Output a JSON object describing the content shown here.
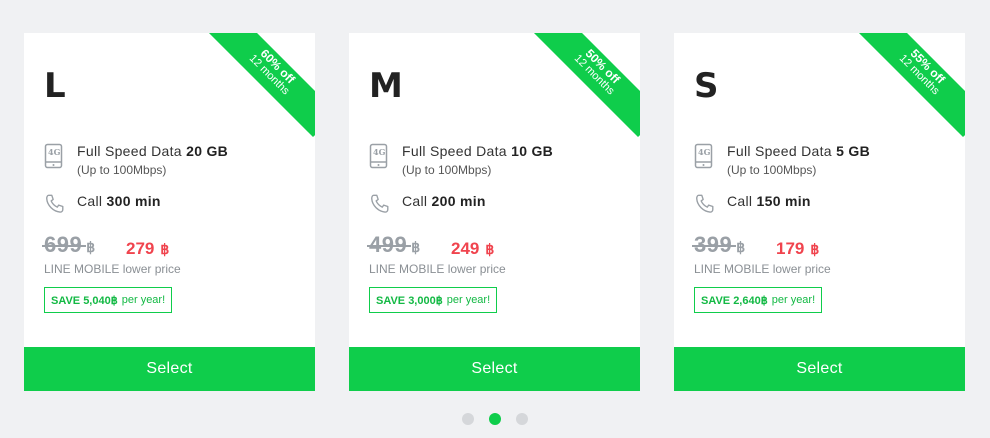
{
  "colors": {
    "accent": "#0fcd4b",
    "sale_price": "#f0444e",
    "old_price": "#9aa0a6",
    "background": "#f0f1f3"
  },
  "plans": [
    {
      "ribbon_pct": "60% off",
      "ribbon_months": "12 months",
      "name": "L",
      "data_label": "Full Speed Data",
      "data_amount": "20 GB",
      "data_sub": "(Up to 100Mbps)",
      "call_label": "Call",
      "call_amount": "300 min",
      "old_price": "699",
      "currency": "฿",
      "new_price": "279",
      "lower_price_label": "LINE MOBILE lower price",
      "save_strong": "SAVE 5,040฿",
      "save_suffix": "per year!",
      "select_label": "Select"
    },
    {
      "ribbon_pct": "50% off",
      "ribbon_months": "12 months",
      "name": "M",
      "data_label": "Full Speed Data",
      "data_amount": "10 GB",
      "data_sub": "(Up to 100Mbps)",
      "call_label": "Call",
      "call_amount": "200 min",
      "old_price": "499",
      "currency": "฿",
      "new_price": "249",
      "lower_price_label": "LINE MOBILE lower price",
      "save_strong": "SAVE 3,000฿",
      "save_suffix": "per year!",
      "select_label": "Select"
    },
    {
      "ribbon_pct": "55% off",
      "ribbon_months": "12 months",
      "name": "S",
      "data_label": "Full Speed Data",
      "data_amount": "5 GB",
      "data_sub": "(Up to 100Mbps)",
      "call_label": "Call",
      "call_amount": "150 min",
      "old_price": "399",
      "currency": "฿",
      "new_price": "179",
      "lower_price_label": "LINE MOBILE lower price",
      "save_strong": "SAVE 2,640฿",
      "save_suffix": "per year!",
      "select_label": "Select"
    }
  ],
  "carousel": {
    "active_index": 1,
    "count": 3
  }
}
